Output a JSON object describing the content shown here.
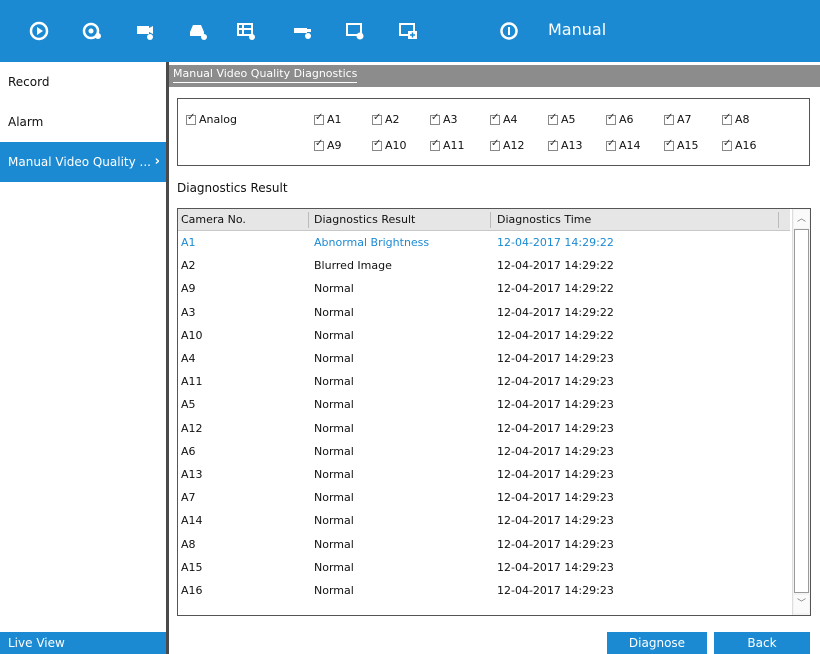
{
  "topbar": {
    "title": "Manual",
    "icons": [
      "playback-icon",
      "camera-settings-icon",
      "record-settings-icon",
      "storage-icon",
      "vca-icon",
      "network-settings-icon",
      "system-settings-icon",
      "maintenance-icon",
      "manual-icon"
    ],
    "accent": "#1b8ad3"
  },
  "sidebar": {
    "items": [
      {
        "label": "Record"
      },
      {
        "label": "Alarm"
      },
      {
        "label": "Manual Video Quality ..."
      }
    ],
    "chevron": "›",
    "live_view": "Live View"
  },
  "main": {
    "tab": "Manual Video Quality Diagnostics",
    "analog_label": "Analog",
    "channels_row1": [
      "A1",
      "A2",
      "A3",
      "A4",
      "A5",
      "A6",
      "A7",
      "A8"
    ],
    "channels_row2": [
      "A9",
      "A10",
      "A11",
      "A12",
      "A13",
      "A14",
      "A15",
      "A16"
    ],
    "section": "Diagnostics Result",
    "columns": [
      "Camera No.",
      "Diagnostics Result",
      "Diagnostics Time"
    ],
    "rows": [
      [
        "A1",
        "Abnormal Brightness",
        "12-04-2017 14:29:22"
      ],
      [
        "A2",
        "Blurred Image",
        "12-04-2017 14:29:22"
      ],
      [
        "A9",
        "Normal",
        "12-04-2017 14:29:22"
      ],
      [
        "A3",
        "Normal",
        "12-04-2017 14:29:22"
      ],
      [
        "A10",
        "Normal",
        "12-04-2017 14:29:22"
      ],
      [
        "A4",
        "Normal",
        "12-04-2017 14:29:23"
      ],
      [
        "A11",
        "Normal",
        "12-04-2017 14:29:23"
      ],
      [
        "A5",
        "Normal",
        "12-04-2017 14:29:23"
      ],
      [
        "A12",
        "Normal",
        "12-04-2017 14:29:23"
      ],
      [
        "A6",
        "Normal",
        "12-04-2017 14:29:23"
      ],
      [
        "A13",
        "Normal",
        "12-04-2017 14:29:23"
      ],
      [
        "A7",
        "Normal",
        "12-04-2017 14:29:23"
      ],
      [
        "A14",
        "Normal",
        "12-04-2017 14:29:23"
      ],
      [
        "A8",
        "Normal",
        "12-04-2017 14:29:23"
      ],
      [
        "A15",
        "Normal",
        "12-04-2017 14:29:23"
      ],
      [
        "A16",
        "Normal",
        "12-04-2017 14:29:23"
      ]
    ],
    "buttons": {
      "diagnose": "Diagnose",
      "back": "Back"
    }
  }
}
